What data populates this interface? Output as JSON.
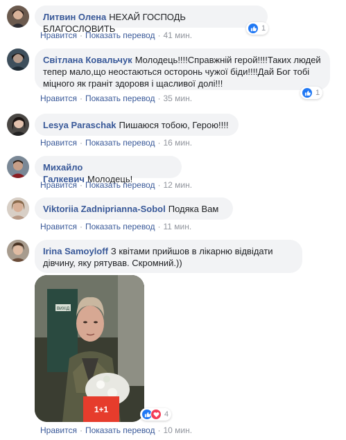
{
  "actions": {
    "like_label": "Нравится",
    "separator": "·",
    "translate_label": "Показать перевод"
  },
  "comments": [
    {
      "author": "Литвин Олена",
      "text": "НЕХАЙ ГОСПОДЬ БЛАГОСЛОВИТЬ",
      "time": "41 мин.",
      "reactions": {
        "types": [
          "like"
        ],
        "count": "1"
      }
    },
    {
      "author": "Світлана Ковальчук",
      "text": "Молодець!!!!Справжній герой!!!!Таких людей тепер мало,що неостаються осторонь чужої біди!!!!Дай Бог тобі міцного як граніт здоровя і щасливої долі!!!",
      "time": "35 мин.",
      "reactions": {
        "types": [
          "like"
        ],
        "count": "1"
      }
    },
    {
      "author": "Lesya Paraschak",
      "text": "Пишаюся тобою, Герою!!!!",
      "time": "16 мин."
    },
    {
      "author": "Михайло Галкевич",
      "text": "Молодець!",
      "time": "12 мин."
    },
    {
      "author": "Viktoriia Zadniprianna-Sobol",
      "text": "Подяка Вам",
      "time": "11 мин."
    },
    {
      "author": "Irina Samoyloff",
      "text": "З квітами прийшов в лікарню відвідати дівчину, яку рятував. Скромний.))",
      "time": "10 мин.",
      "reactions": {
        "types": [
          "like",
          "love"
        ],
        "count": "4"
      },
      "photo": {
        "sign_text": "ВИХІД",
        "logo_text": "1+1"
      }
    }
  ],
  "colors": {
    "link": "#385898",
    "meta": "#90949c",
    "bubble": "#f2f3f5",
    "like": "#2078f4",
    "love": "#f33e58"
  }
}
